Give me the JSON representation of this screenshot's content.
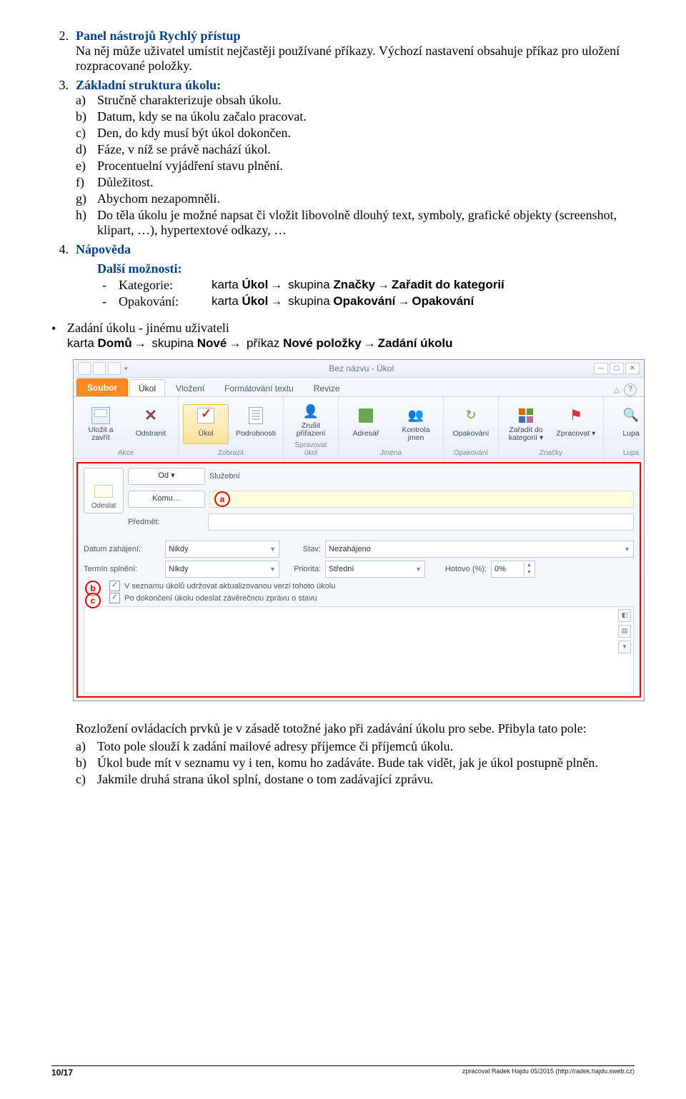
{
  "sec2": {
    "title": "Panel nástrojů Rychlý přístup",
    "p": "Na něj může uživatel umístit nejčastěji používané příkazy. Výchozí nastavení obsahuje příkaz pro uložení rozpracované položky."
  },
  "sec3": {
    "title": "Základní struktura úkolu:",
    "items": {
      "a": "Stručně charakterizuje obsah úkolu.",
      "b": "Datum, kdy se na úkolu začalo pracovat.",
      "c": "Den, do kdy musí být úkol dokončen.",
      "d": "Fáze, v níž se právě nachází úkol.",
      "e": "Procentuelní vyjádření stavu plnění.",
      "f": "Důležitost.",
      "g": "Abychom nezapomněli.",
      "h": "Do těla úkolu je možné napsat či vložit libovolně dlouhý text, symboly, grafické objekty (screenshot, klipart, …), hypertextové odkazy, …"
    }
  },
  "sec4": {
    "title": "Nápověda",
    "dalsi_title": "Další možnosti:",
    "kat_label": "Kategorie:",
    "kat_val": {
      "pre": "karta ",
      "b1": "Úkol",
      "mid1": " skupina ",
      "b2": "Značky",
      "mid2": " ",
      "b3": "Zařadit do kategorií"
    },
    "op_label": "Opakování:",
    "op_val": {
      "pre": "karta ",
      "b1": "Úkol",
      "mid1": " skupina ",
      "b2": "Opakování",
      "mid2": " ",
      "b3": "Opakování"
    }
  },
  "zadani": {
    "title": "Zadání úkolu - jinému uživateli",
    "path": {
      "pre": "karta ",
      "b1": "Domů",
      "m1": " skupina ",
      "b2": "Nové",
      "m2": " příkaz ",
      "b3": "Nové položky",
      "m3": " ",
      "b4": "Zadání úkolu"
    }
  },
  "shot": {
    "title": "Bez názvu - Úkol",
    "tabs": {
      "file": "Soubor",
      "ukol": "Úkol",
      "vlozeni": "Vložení",
      "format": "Formátování textu",
      "revize": "Revize"
    },
    "groups": {
      "akce": {
        "label": "Akce",
        "save": "Uložit a zavřít",
        "del": "Odstranit"
      },
      "zobrazit": {
        "label": "Zobrazit",
        "ukol": "Úkol",
        "podrob": "Podrobnosti"
      },
      "spravovat": {
        "label": "Spravovat úkol",
        "zrusit": "Zrušit přiřazení"
      },
      "jmena": {
        "label": "Jména",
        "adr": "Adresář",
        "kontrola": "Kontrola jmen"
      },
      "opakovani": {
        "label": "Opakování",
        "op": "Opakování"
      },
      "znacky": {
        "label": "Značky",
        "kat": "Zařadit do kategorií ▾",
        "zpr": "Zpracovat ▾"
      },
      "lupa": {
        "label": "Lupa",
        "lupa": "Lupa"
      }
    },
    "form": {
      "send": "Odeslat",
      "od": "Od ▾",
      "od_val": "Služební",
      "komu": "Komu…",
      "predmet": "Předmět:",
      "zahaj": "Datum zahájení:",
      "zahaj_val": "Nikdy",
      "stav": "Stav:",
      "stav_val": "Nezahájeno",
      "splneni": "Termín splnění:",
      "splneni_val": "Nikdy",
      "priorita": "Priorita:",
      "priorita_val": "Střední",
      "hotovo": "Hotovo (%):",
      "hotovo_val": "0%",
      "chk1": "V seznamu úkolů udržovat aktualizovanou verzi tohoto úkolu",
      "chk2": "Po dokončení úkolu odeslat závěrečnou zprávu o stavu"
    }
  },
  "after": {
    "p1": "Rozložení ovládacích prvků je v zásadě totožné jako při zadávání úkolu pro sebe. Přibyla tato pole:",
    "a": "Toto pole slouží k zadání mailové adresy příjemce či příjemců úkolu.",
    "b": "Úkol bude mít v seznamu vy i ten, komu ho zadáváte. Bude tak vidět, jak je úkol postupně plněn.",
    "c": "Jakmile druhá strana úkol splní, dostane o tom zadávající zprávu."
  },
  "footer": {
    "page": "10/17",
    "src": "zpracoval Radek Hajdu 05/2015 (http://radek.hajdu.sweb.cz)"
  }
}
